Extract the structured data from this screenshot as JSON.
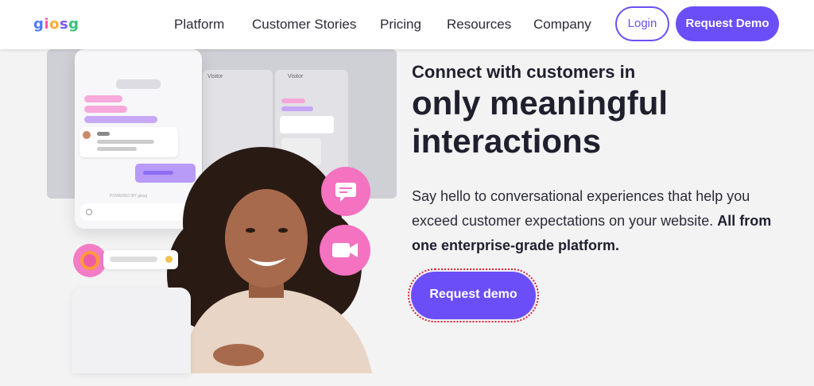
{
  "brand": {
    "logo": "giosg"
  },
  "nav": {
    "items": [
      "Platform",
      "Customer Stories",
      "Pricing",
      "Resources",
      "Company"
    ],
    "login": "Login",
    "request_demo": "Request Demo"
  },
  "hero": {
    "kicker": "Connect with customers in",
    "headline": "only meaningful interactions",
    "sub_line": "Say hello to conversational experiences that help you exceed customer expectations on your website.",
    "sub_bold": "All from one enterprise-grade platform.",
    "cta": "Request demo"
  },
  "illustration": {
    "chat_icon": "chat-bubble-icon",
    "video_icon": "video-camera-icon",
    "widget_label_1": "Visitor",
    "widget_label_2": "Visitor",
    "powered_by": "POWERED BY giosg"
  },
  "colors": {
    "accent": "#6c4ef8",
    "pink": "#f472c0",
    "background": "#f3f3f4"
  }
}
